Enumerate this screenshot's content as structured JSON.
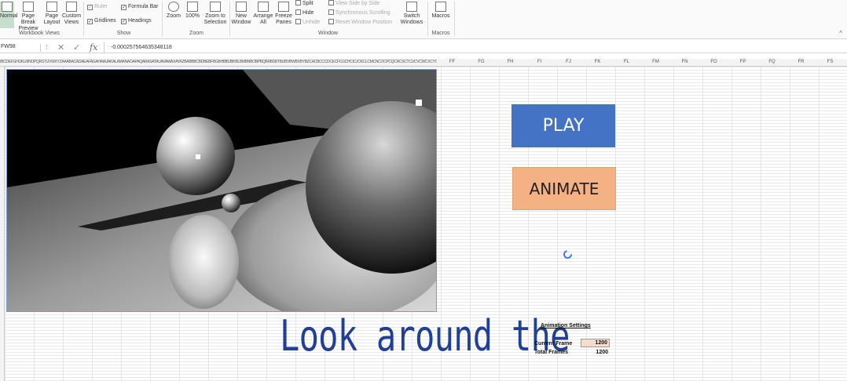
{
  "ribbon": {
    "views": {
      "normal": "Normal",
      "page_break": "Page Break Preview",
      "page_layout": "Page Layout",
      "custom_views": "Custom Views",
      "group": "Workbook Views"
    },
    "show": {
      "ruler": "Ruler",
      "formula_bar": "Formula Bar",
      "gridlines": "Gridlines",
      "headings": "Headings",
      "group": "Show"
    },
    "zoom": {
      "zoom": "Zoom",
      "hundred": "100%",
      "to_selection": "Zoom to Selection",
      "group": "Zoom"
    },
    "window": {
      "new_window": "New Window",
      "arrange_all": "Arrange All",
      "freeze_panes": "Freeze Panes",
      "split": "Split",
      "hide": "Hide",
      "unhide": "Unhide",
      "side_by_side": "View Side by Side",
      "sync_scroll": "Synchronous Scrolling",
      "reset_pos": "Reset Window Position",
      "switch": "Switch Windows",
      "group": "Window"
    },
    "macros": {
      "label": "Macros",
      "group": "Macros"
    }
  },
  "formula_bar": {
    "name_box": "FW98",
    "formula": "-0.000257564635348118"
  },
  "columns": {
    "stub": "/BCDEFGHIJKLMNOPQRSTUVWXYZAAABACADAEAFAGAHAIAJAKALAMANAOAPAQARASATAUAVAWAXAYAZBABBBCBDBEBFBGBHBIBJBKBLBMBNBOBPBQBRBSBTBUBVBWBXBYBZCACBCCCDCECFCGCHCICJCKCLCMCNCOCPCQCRCSCTCUCVCWCXCYCZDADBDCDDDEDFDGDHDIDJDKDLDMDNDODPDQDRDSDTDUDVDWDXDYDZEAEBECEDEEEFEGEHEIEJEKELEMENEOEPEQERESETEUEVEWEXEYEZFAFBFCFDFE",
    "labels": [
      "FF",
      "FG",
      "FH",
      "FI",
      "FJ",
      "FK",
      "FL",
      "FM",
      "FN",
      "FO",
      "FP",
      "FQ",
      "FR",
      "FS"
    ]
  },
  "buttons": {
    "play": "PLAY",
    "animate": "ANIMATE"
  },
  "caption": "Look around the",
  "settings": {
    "title": "Animation Settings",
    "current_label": "Current Frame",
    "current_value": "1200",
    "total_label": "Total Frames",
    "total_value": "1200"
  }
}
